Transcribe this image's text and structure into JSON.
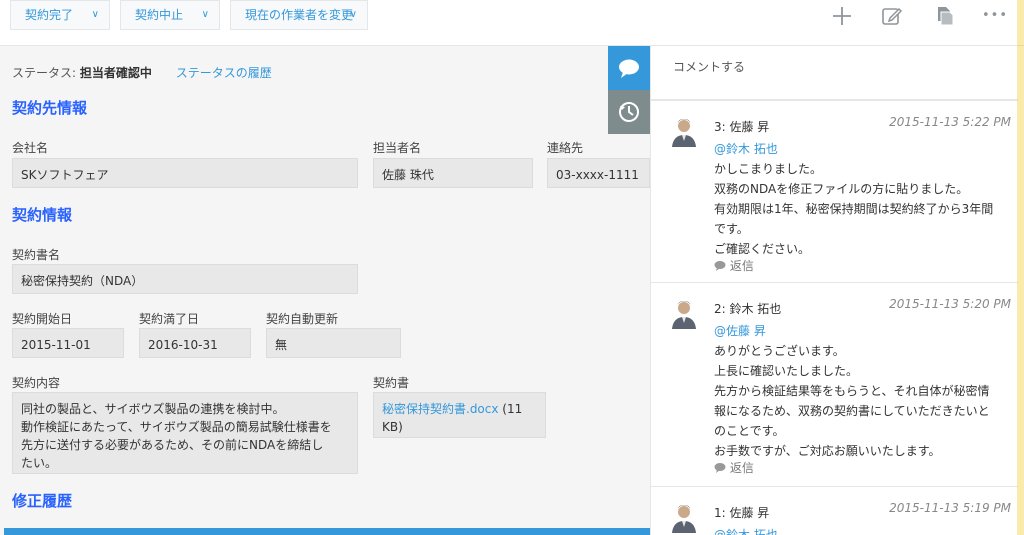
{
  "toolbar": {
    "actions": [
      {
        "label": "契約完了"
      },
      {
        "label": "契約中止"
      },
      {
        "label": "現在の作業者を変更"
      }
    ],
    "icons": {
      "add": "plus-icon",
      "edit": "edit-icon",
      "copy": "copy-icon",
      "more": "more-icon"
    },
    "more_glyph": "•••"
  },
  "status": {
    "label": "ステータス:",
    "value": "担当者確認中",
    "history_link": "ステータスの履歴"
  },
  "sections": {
    "partner": "契約先情報",
    "contract": "契約情報",
    "revision": "修正履歴"
  },
  "fields": {
    "company": {
      "label": "会社名",
      "value": "SKソフトフェア"
    },
    "contact_person": {
      "label": "担当者名",
      "value": "佐藤 珠代"
    },
    "contact": {
      "label": "連絡先",
      "value": "03-xxxx-1111"
    },
    "contract_name": {
      "label": "契約書名",
      "value": "秘密保持契約（NDA）"
    },
    "start_date": {
      "label": "契約開始日",
      "value": "2015-11-01"
    },
    "end_date": {
      "label": "契約満了日",
      "value": "2016-10-31"
    },
    "auto_renew": {
      "label": "契約自動更新",
      "value": "無"
    },
    "content": {
      "label": "契約内容",
      "lines": [
        "同社の製品と、サイボウズ製品の連携を検討中。",
        "動作検証にあたって、サイボウズ製品の簡易試験仕様書を",
        "先方に送付する必要があるため、その前にNDAを締結し",
        "たい。"
      ]
    },
    "document": {
      "label": "契約書",
      "file_name": "秘密保持契約書.docx",
      "file_size_a": " (11",
      "file_size_b": "KB)"
    }
  },
  "comments_panel": {
    "placeholder": "コメントする",
    "reply_label": "返信",
    "comments": [
      {
        "author": "3: 佐藤 昇",
        "date": "2015-11-13 5:22 PM",
        "mention": "@鈴木 拓也",
        "lines": [
          "かしこまりました。",
          "双務のNDAを修正ファイルの方に貼りました。",
          "有効期限は1年、秘密保持期間は契約終了から3年間",
          "です。",
          "ご確認ください。"
        ]
      },
      {
        "author": "2: 鈴木 拓也",
        "date": "2015-11-13 5:20 PM",
        "mention": "@佐藤 昇",
        "lines": [
          "ありがとうございます。",
          "上長に確認いたしました。",
          "先方から検証結果等をもらうと、それ自体が秘密情",
          "報になるため、双務の契約書にしていただきたいと",
          "のことです。",
          "お手数ですが、ご対応お願いいたします。"
        ]
      },
      {
        "author": "1: 佐藤 昇",
        "date": "2015-11-13 5:19 PM",
        "mention": "@鈴木 拓也",
        "lines": []
      }
    ]
  },
  "colors": {
    "accent": "#3498db",
    "section_title": "#2962ff",
    "side_tab_inactive": "#7f8c8d"
  }
}
